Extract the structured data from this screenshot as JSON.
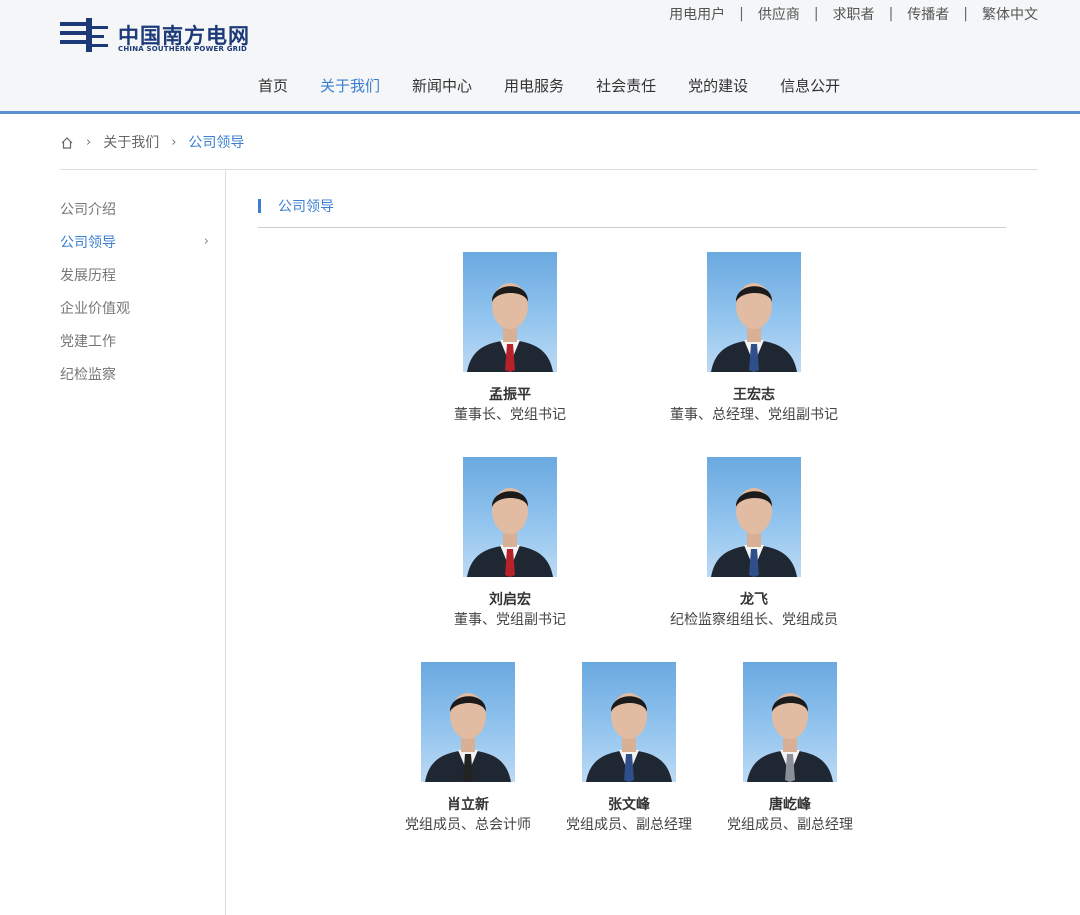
{
  "brand": {
    "name_cn": "中国南方电网",
    "name_en": "CHINA SOUTHERN POWER GRID",
    "color": "#1d3a78"
  },
  "top_links": [
    "用电用户",
    "供应商",
    "求职者",
    "传播者",
    "繁体中文"
  ],
  "main_nav": {
    "items": [
      "首页",
      "关于我们",
      "新闻中心",
      "用电服务",
      "社会责任",
      "党的建设",
      "信息公开"
    ],
    "active": "关于我们"
  },
  "breadcrumb": {
    "home_icon": "home-icon",
    "items": [
      "关于我们",
      "公司领导"
    ]
  },
  "sidebar": {
    "items": [
      "公司介绍",
      "公司领导",
      "发展历程",
      "企业价值观",
      "党建工作",
      "纪检监察"
    ],
    "active": "公司领导"
  },
  "section": {
    "title": "公司领导"
  },
  "leaders": [
    {
      "name": "孟振平",
      "title": "董事长、党组书记",
      "tie": "red"
    },
    {
      "name": "王宏志",
      "title": "董事、总经理、党组副书记",
      "tie": "blue"
    },
    {
      "name": "刘启宏",
      "title": "董事、党组副书记",
      "tie": "red"
    },
    {
      "name": "龙飞",
      "title": "纪检监察组组长、党组成员",
      "tie": "blue"
    },
    {
      "name": "肖立新",
      "title": "党组成员、总会计师",
      "tie": "dark"
    },
    {
      "name": "张文峰",
      "title": "党组成员、副总经理",
      "tie": "blue"
    },
    {
      "name": "唐屹峰",
      "title": "党组成员、副总经理",
      "tie": "grey"
    }
  ],
  "colors": {
    "accent": "#3a7fd0",
    "header_bg": "#f4f6f8",
    "header_line": "#5b8fd0"
  }
}
